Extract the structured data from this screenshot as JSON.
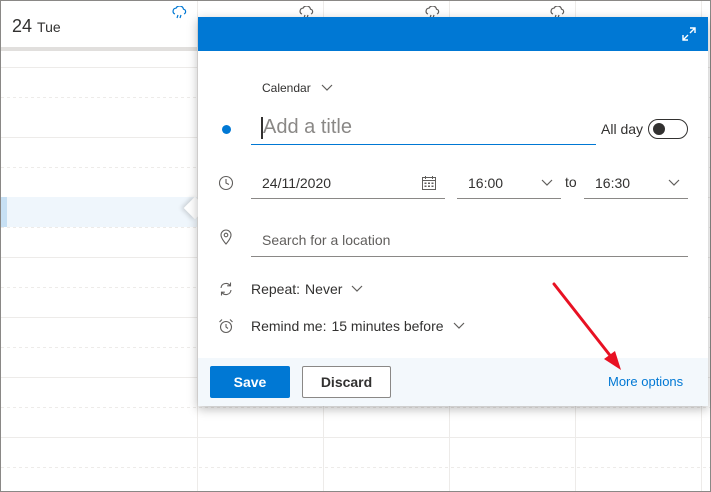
{
  "calendar": {
    "day_number": "24",
    "day_name": "Tue",
    "weather_icons": [
      "cloud-rain-icon",
      "cloud-rain-icon",
      "cloud-rain-icon",
      "cloud-rain-icon"
    ]
  },
  "popup": {
    "calendar_label": "Calendar",
    "title_placeholder": "Add a title",
    "allday_label": "All day",
    "allday_on": false,
    "date_value": "24/11/2020",
    "start_time": "16:00",
    "to_label": "to",
    "end_time": "16:30",
    "location_placeholder": "Search for a location",
    "repeat_label": "Repeat:",
    "repeat_value": "Never",
    "remind_label": "Remind me:",
    "remind_value": "15 minutes before",
    "save_label": "Save",
    "discard_label": "Discard",
    "more_options_label": "More options"
  },
  "colors": {
    "accent": "#0078d4",
    "annotation_arrow": "#e81123"
  }
}
